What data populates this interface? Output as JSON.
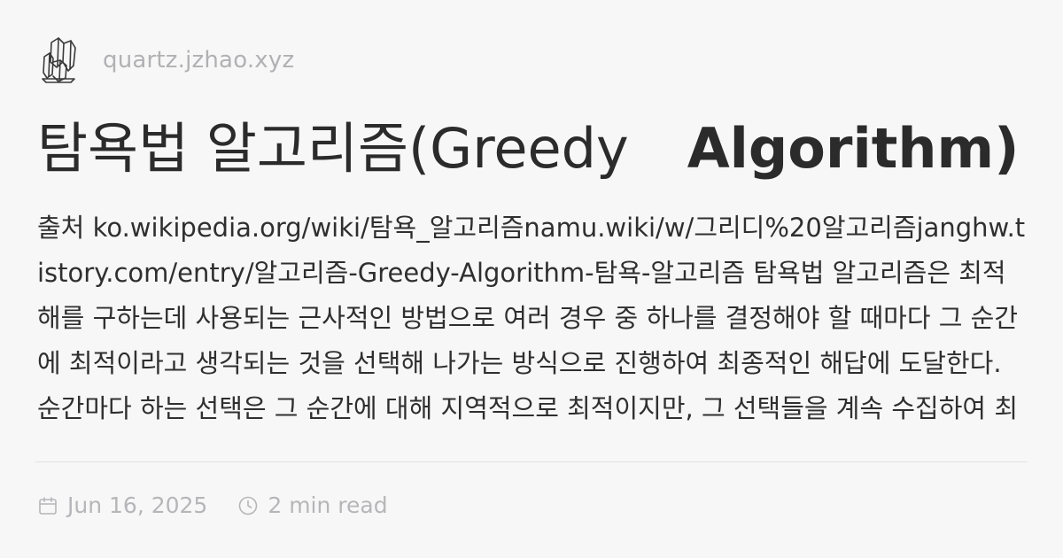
{
  "site": {
    "name": "quartz.jzhao.xyz",
    "logo_icon": "crystal-logo-icon"
  },
  "article": {
    "title_part1": "탐욕법 알고리즘(Greedy",
    "title_part2": "Algorithm)",
    "description": "출처 ko.wikipedia.org/wiki/탐욕_알고리즘namu.wiki/w/그리디%20알고리즘janghw.tistory.com/entry/알고리즘-Greedy-Algorithm-탐욕-알고리즘 탐욕법 알고리즘은 최적해를 구하는데 사용되는 근사적인 방법으로 여러 경우 중 하나를 결정해야 할 때마다 그 순간에 최적이라고 생각되는 것을 선택해 나가는 방식으로 진행하여 최종적인 해답에 도달한다. 순간마다 하는 선택은 그 순간에 대해 지역적으로 최적이지만, 그 선택들을 계속 수집하여 최종적(전역적..."
  },
  "meta": {
    "date": "Jun 16, 2025",
    "reading_time": "2 min read",
    "calendar_icon": "calendar-icon",
    "clock_icon": "clock-icon"
  },
  "colors": {
    "background": "#f8f7f7",
    "text": "#2b2b2b",
    "muted": "#b1b1b4",
    "divider": "#e3e2e2"
  }
}
